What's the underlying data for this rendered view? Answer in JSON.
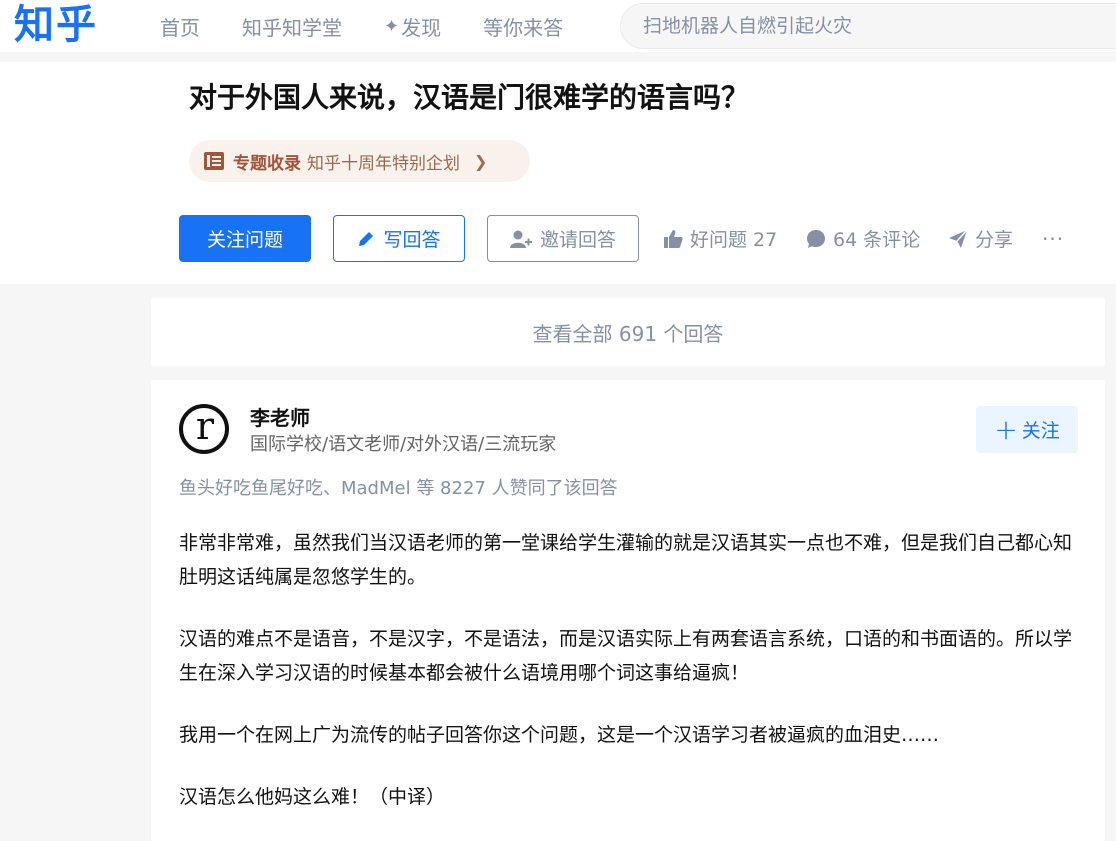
{
  "header": {
    "logo": "知乎",
    "nav": [
      "首页",
      "知乎知学堂",
      "发现",
      "等你来答"
    ],
    "search_placeholder": "扫地机器人自燃引起火灾"
  },
  "question": {
    "title": "对于外国人来说，汉语是门很难学的语言吗？",
    "topic_strong": "专题收录",
    "topic_label": "知乎十周年特别企划",
    "follow_label": "关注问题",
    "write_label": "写回答",
    "invite_label": "邀请回答",
    "good_label": "好问题 27",
    "comment_label": "64 条评论",
    "share_label": "分享",
    "more_label": "···"
  },
  "view_all": "查看全部 691 个回答",
  "answer": {
    "author_name": "李老师",
    "author_bio": "国际学校/语文老师/对外汉语/三流玩家",
    "avatar_letter": "r",
    "follow_label": "关注",
    "voters": "鱼头好吃鱼尾好吃、MadMel 等 8227 人赞同了该回答",
    "paragraphs": [
      "非常非常难，虽然我们当汉语老师的第一堂课给学生灌输的就是汉语其实一点也不难，但是我们自己都心知肚明这话纯属是忽悠学生的。",
      "汉语的难点不是语音，不是汉字，不是语法，而是汉语实际上有两套语言系统，口语的和书面语的。所以学生在深入学习汉语的时候基本都会被什么语境用哪个词这事给逼疯！",
      "我用一个在网上广为流传的帖子回答你这个问题，这是一个汉语学习者被逼疯的血泪史……",
      "汉语怎么他妈这么难！（中译）"
    ]
  },
  "colors": {
    "brand": "#1772f6",
    "muted": "#8590a6",
    "tag_bg": "#f9f1ec"
  }
}
